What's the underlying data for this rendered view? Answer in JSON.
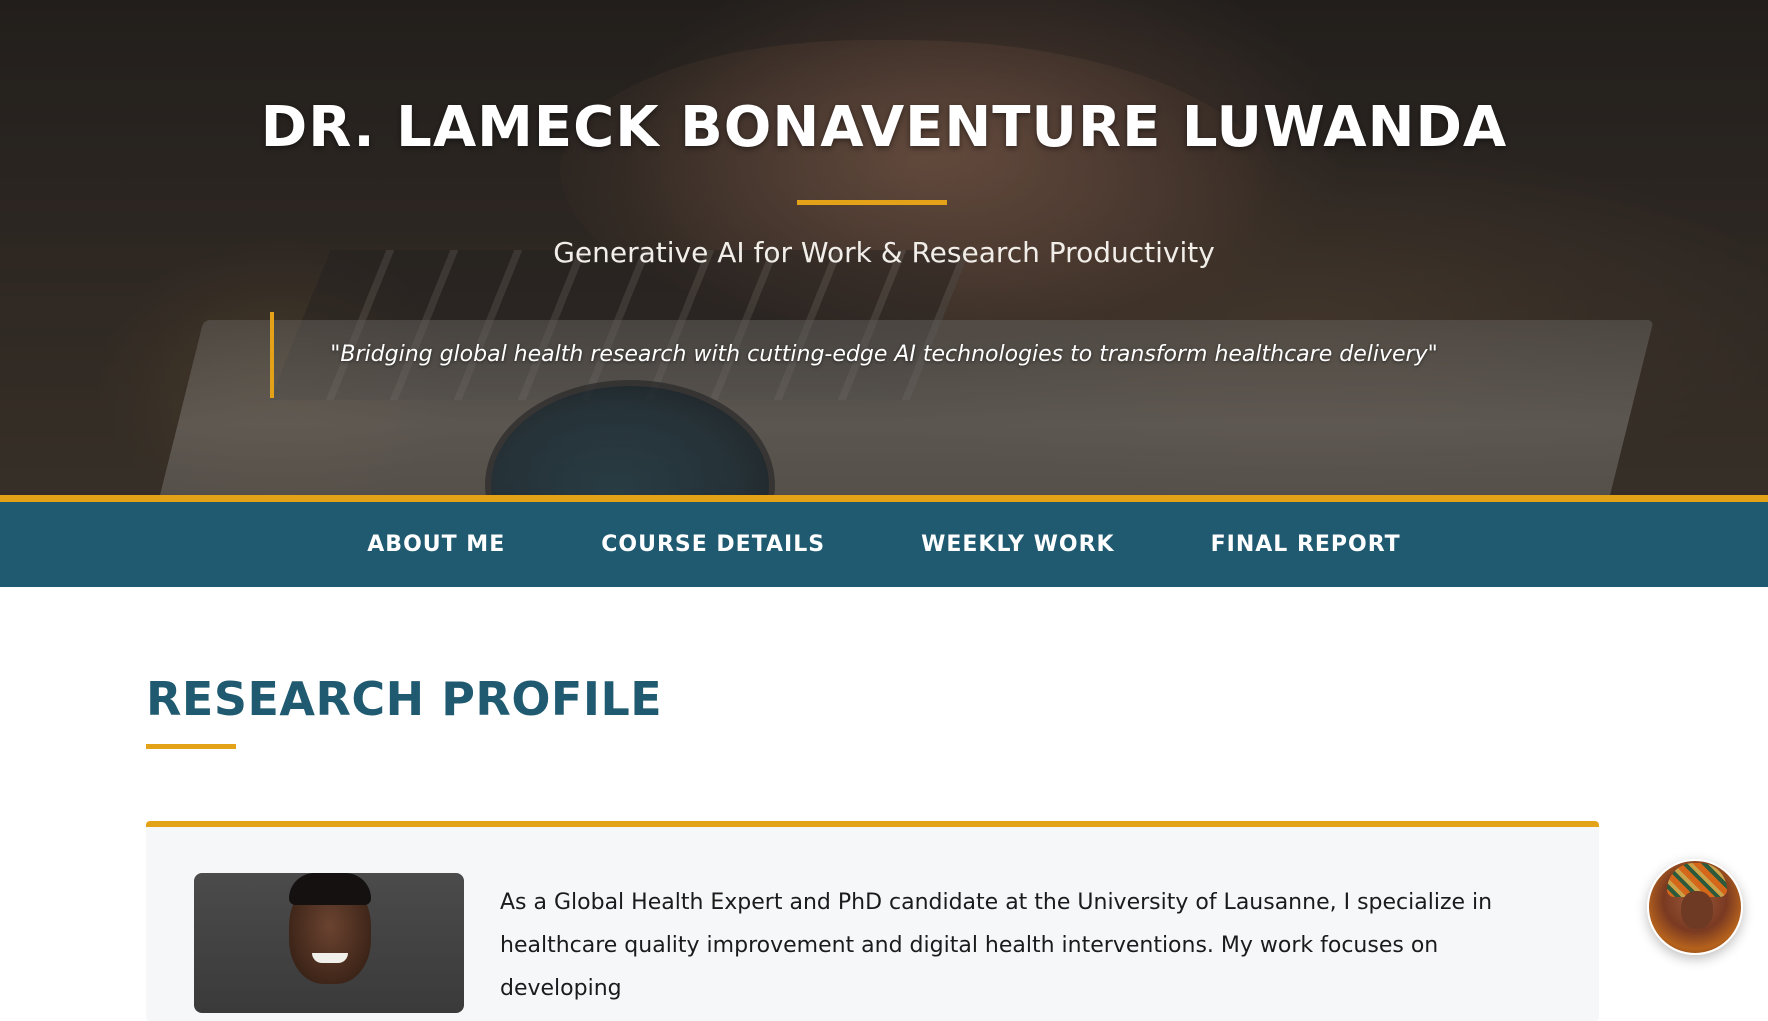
{
  "hero": {
    "title": "DR. LAMECK BONAVENTURE LUWANDA",
    "subtitle": "Generative AI for Work & Research Productivity",
    "quote": "\"Bridging global health research with cutting-edge AI technologies to transform healthcare delivery\""
  },
  "nav": {
    "items": [
      {
        "label": "ABOUT ME"
      },
      {
        "label": "COURSE DETAILS"
      },
      {
        "label": "WEEKLY WORK"
      },
      {
        "label": "FINAL REPORT"
      }
    ]
  },
  "main": {
    "section_title": "RESEARCH PROFILE",
    "profile_text": "As a Global Health Expert and PhD candidate at the University of Lausanne, I specialize in healthcare quality improvement and digital health interventions. My work focuses on developing"
  },
  "colors": {
    "accent": "#e3a217",
    "nav_bg": "#1f5a70",
    "heading": "#1f5a70"
  }
}
